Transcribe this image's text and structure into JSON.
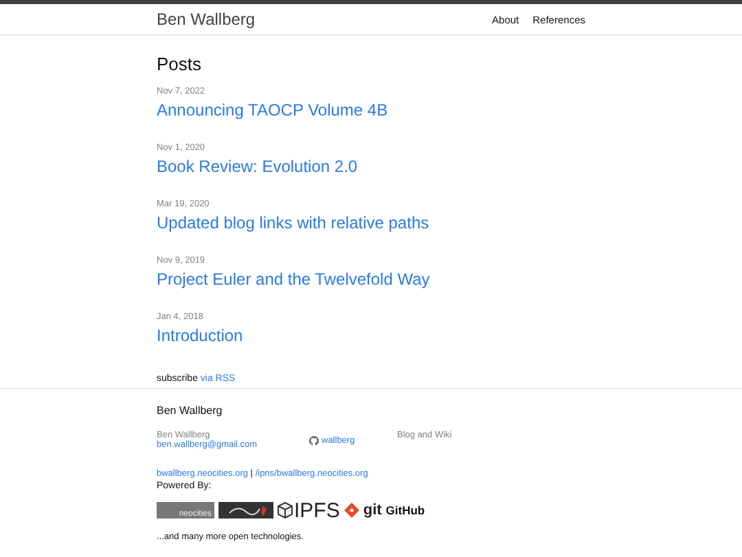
{
  "header": {
    "site_title": "Ben Wallberg",
    "nav": [
      "About",
      "References"
    ]
  },
  "posts": {
    "heading": "Posts",
    "items": [
      {
        "date": "Nov 7, 2022",
        "title": "Announcing TAOCP Volume 4B"
      },
      {
        "date": "Nov 1, 2020",
        "title": "Book Review: Evolution 2.0"
      },
      {
        "date": "Mar 19, 2020",
        "title": "Updated blog links with relative paths"
      },
      {
        "date": "Nov 9, 2019",
        "title": "Project Euler and the Twelvefold Way"
      },
      {
        "date": "Jan 4, 2018",
        "title": "Introduction"
      }
    ],
    "subscribe": {
      "text": "subscribe",
      "link": "via RSS"
    }
  },
  "footer": {
    "title": "Ben Wallberg",
    "name": "Ben Wallberg",
    "email": "ben.wallberg@gmail.com",
    "github": "wallberg",
    "description": "Blog and Wiki",
    "site_link": "bwallberg.neocities.org",
    "separator": "|",
    "ipns_link": "/ipns/bwallberg.neocities.org",
    "powered_by": "Powered By:",
    "badges": [
      {
        "kind": "neocities",
        "text": "neocities"
      },
      {
        "kind": "jekyll"
      },
      {
        "kind": "ipfs",
        "text": "IPFS"
      },
      {
        "kind": "git",
        "text": "git"
      },
      {
        "kind": "github",
        "text": "GitHub"
      }
    ],
    "closing": "...and many more open technologies."
  }
}
